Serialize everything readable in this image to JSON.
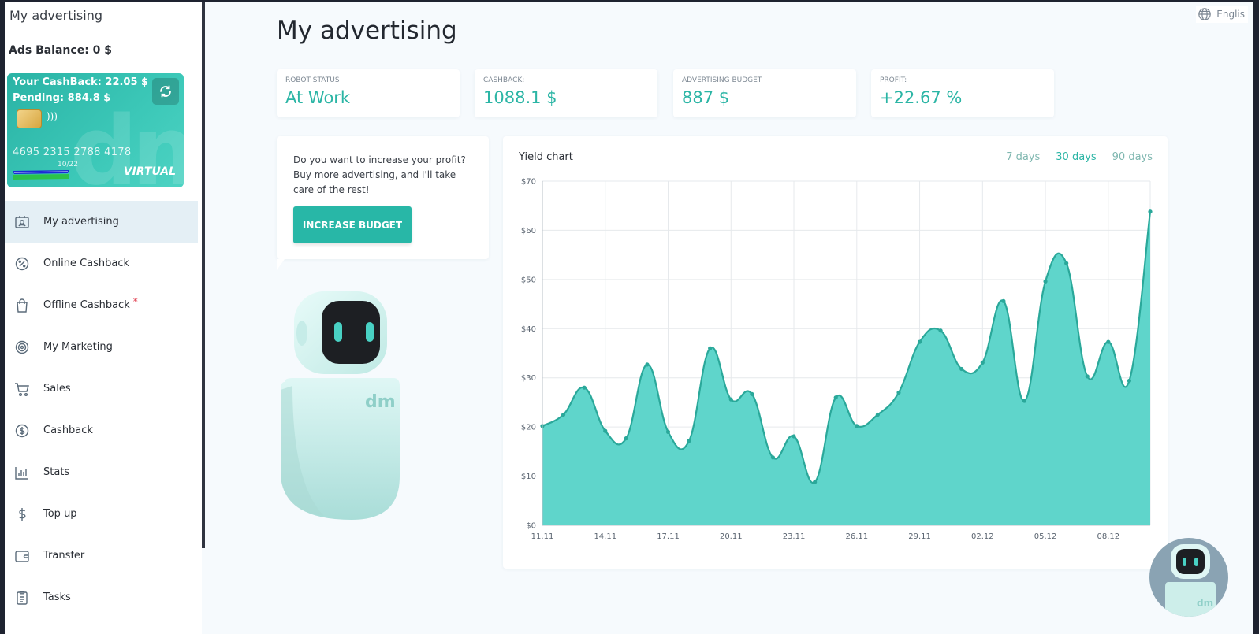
{
  "sidebar": {
    "title": "My advertising",
    "ads_balance": "Ads Balance: 0 $",
    "card": {
      "cashback": "Your CashBack: 22.05 $",
      "pending": "Pending: 884.8 $",
      "number": "4695 2315 2788 4178",
      "expiry": "10/22",
      "type": "VIRTUAL",
      "logo_mark": "dm"
    },
    "nav": [
      {
        "label": "My advertising",
        "icon": "person-card-icon",
        "active": true
      },
      {
        "label": "Online Cashback",
        "icon": "percent-badge-icon"
      },
      {
        "label": "Offline Cashback",
        "icon": "shopping-bag-icon",
        "required": "*"
      },
      {
        "label": "My Marketing",
        "icon": "target-icon"
      },
      {
        "label": "Sales",
        "icon": "cart-icon"
      },
      {
        "label": "Cashback",
        "icon": "dollar-circle-icon"
      },
      {
        "label": "Stats",
        "icon": "bar-chart-icon"
      },
      {
        "label": "Top up",
        "icon": "dollar-icon"
      },
      {
        "label": "Transfer",
        "icon": "wallet-icon"
      },
      {
        "label": "Tasks",
        "icon": "clipboard-icon"
      }
    ]
  },
  "header": {
    "language": "Englis",
    "page_title": "My advertising"
  },
  "stats": [
    {
      "label": "ROBOT STATUS",
      "value": "At Work"
    },
    {
      "label": "CASHBACK:",
      "value": "1088.1 $"
    },
    {
      "label": "ADVERTISING BUDGET",
      "value": "887 $"
    },
    {
      "label": "PROFIT:",
      "value": "+22.67 %"
    }
  ],
  "tip": {
    "text": "Do you want to increase your profit? Buy more advertising, and I'll take care of the rest!",
    "button": "INCREASE BUDGET"
  },
  "robot": {
    "logo_mark": "dm"
  },
  "chart_panel": {
    "title": "Yield chart",
    "ranges": [
      "7 days",
      "30 days",
      "90 days"
    ],
    "active_range": "30 days"
  },
  "colors": {
    "accent": "#2bb5a5",
    "area_fill": "#5fd5cb",
    "line": "#2aa89a"
  },
  "chart_data": {
    "type": "area",
    "x": [
      "11.11",
      "12.11",
      "13.11",
      "14.11",
      "15.11",
      "16.11",
      "17.11",
      "18.11",
      "19.11",
      "20.11",
      "21.11",
      "22.11",
      "23.11",
      "24.11",
      "25.11",
      "26.11",
      "27.11",
      "28.11",
      "29.11",
      "30.11",
      "01.12",
      "02.12",
      "03.12",
      "04.12",
      "05.12",
      "06.12",
      "07.12",
      "08.12",
      "09.12",
      "10.12"
    ],
    "series": [
      {
        "values": [
          20.2,
          22.5,
          28,
          19.2,
          17.7,
          32.7,
          19,
          17.2,
          36,
          25.6,
          26.7,
          13.8,
          18.1,
          8.8,
          26,
          20.2,
          22.5,
          27,
          37.3,
          39.6,
          31.8,
          33.1,
          45.6,
          25.3,
          49.6,
          53.3,
          30.3,
          37.3,
          29.4,
          63.8
        ]
      }
    ],
    "xticks": [
      "11.11",
      "14.11",
      "17.11",
      "20.11",
      "23.11",
      "26.11",
      "29.11",
      "02.12",
      "05.12",
      "08.12"
    ],
    "yticks": [
      "$0",
      "$10",
      "$20",
      "$30",
      "$40",
      "$50",
      "$60",
      "$70"
    ],
    "ylim": [
      0,
      70
    ],
    "grid": true,
    "legend": false
  }
}
